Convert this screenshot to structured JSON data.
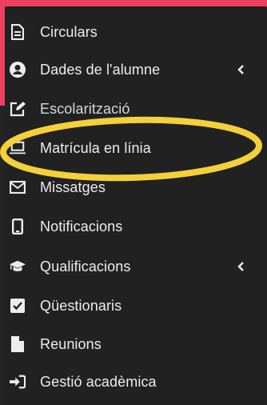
{
  "colors": {
    "accent": "#ed3f60",
    "sidebar_bg": "#212121",
    "text": "#ededed",
    "highlight": "#f4d03a"
  },
  "sidebar": {
    "items": [
      {
        "label": "Circulars",
        "icon": "file-text-icon",
        "expandable": false
      },
      {
        "label": "Dades de l'alumne",
        "icon": "user-circle-icon",
        "expandable": true
      },
      {
        "label": "Escolarització",
        "icon": "edit-icon",
        "expandable": false
      },
      {
        "label": "Matrícula en línia",
        "icon": "laptop-icon",
        "expandable": false,
        "highlighted": true
      },
      {
        "label": "Missatges",
        "icon": "envelope-icon",
        "expandable": false
      },
      {
        "label": "Notificacions",
        "icon": "mobile-icon",
        "expandable": false
      },
      {
        "label": "Qualificacions",
        "icon": "graduation-cap-icon",
        "expandable": true
      },
      {
        "label": "Qüestionaris",
        "icon": "check-square-icon",
        "expandable": false
      },
      {
        "label": "Reunions",
        "icon": "file-icon",
        "expandable": false
      },
      {
        "label": "Gestió acadèmica",
        "icon": "sign-in-icon",
        "expandable": false
      }
    ]
  }
}
